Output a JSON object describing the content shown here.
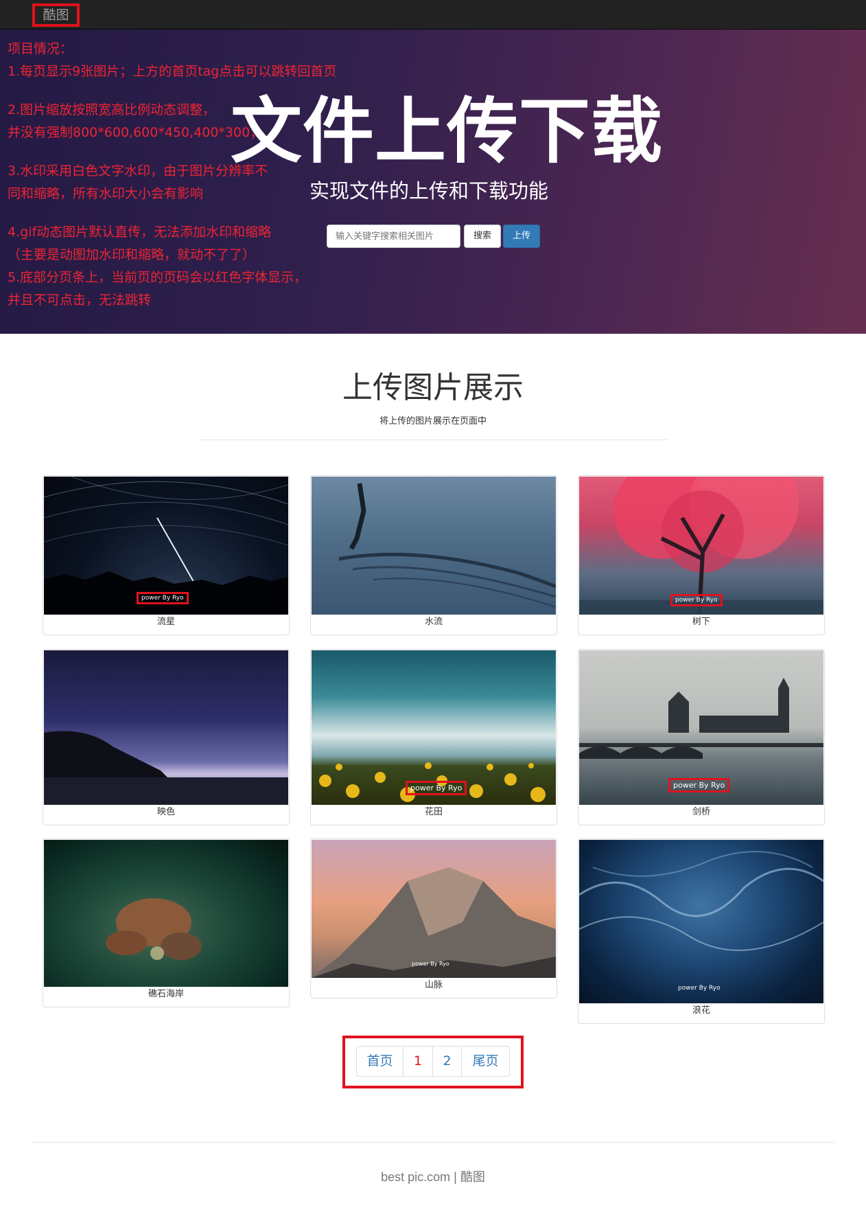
{
  "navbar": {
    "brand": "酷图"
  },
  "hero": {
    "notes": [
      "项目情况：",
      "1.每页显示9张图片；上方的首页tag点击可以跳转回首页",
      "2.图片缩放按照宽高比例动态调整，",
      "并没有强制800*600,600*450,400*300；",
      "3.水印采用白色文字水印，由于图片分辨率不",
      "同和缩略，所有水印大小会有影响",
      "4.gif动态图片默认直传，无法添加水印和缩略",
      "（主要是动图加水印和缩略，就动不了了）",
      "5.底部分页条上，当前页的页码会以红色字体显示，",
      "并且不可点击，无法跳转"
    ],
    "title": "文件上传下载",
    "subtitle": "实现文件的上传和下载功能",
    "search_placeholder": "输入关键字搜索相关图片",
    "search_button": "搜索",
    "upload_button": "上传"
  },
  "section": {
    "title": "上传图片展示",
    "subtitle": "将上传的图片展示在页面中"
  },
  "gallery": [
    {
      "caption": "流星",
      "watermark": "power By Ryo"
    },
    {
      "caption": "水流",
      "watermark": ""
    },
    {
      "caption": "树下",
      "watermark": "power By Ryo"
    },
    {
      "caption": "映色",
      "watermark": ""
    },
    {
      "caption": "花田",
      "watermark": "power By Ryo"
    },
    {
      "caption": "剑桥",
      "watermark": "power By Ryo"
    },
    {
      "caption": "礁石海岸",
      "watermark": ""
    },
    {
      "caption": "山脉",
      "watermark": "power By Ryo"
    },
    {
      "caption": "浪花",
      "watermark": "power By Ryo"
    }
  ],
  "pagination": {
    "first": "首页",
    "pages": [
      "1",
      "2"
    ],
    "current": "1",
    "last": "尾页"
  },
  "footer": {
    "site": "best pic.com",
    "separator": "|",
    "brand": "酷图"
  }
}
